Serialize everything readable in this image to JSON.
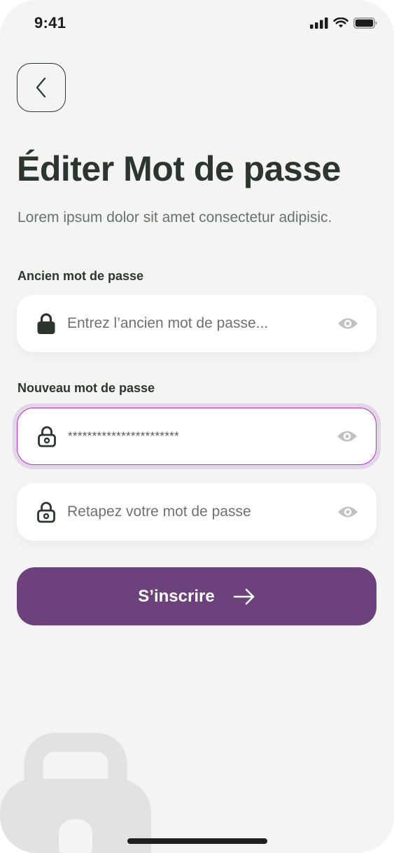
{
  "status_bar": {
    "time": "9:41",
    "icons": [
      "signal-icon",
      "wifi-icon",
      "battery-icon"
    ]
  },
  "header": {
    "back_icon": "chevron-left-icon",
    "title": "Éditer Mot de passe",
    "subtitle": "Lorem ipsum dolor sit amet consectetur adipisic."
  },
  "form": {
    "old_password": {
      "label": "Ancien mot de passe",
      "placeholder": "Entrez l’ancien mot de passe...",
      "value": "",
      "icon": "lock-icon",
      "toggle_icon": "eye-icon"
    },
    "new_password": {
      "label": "Nouveau mot de passe",
      "value": "***********************",
      "icon": "lock-icon",
      "toggle_icon": "eye-icon",
      "focused": true
    },
    "confirm_password": {
      "placeholder": "Retapez votre mot de passe",
      "value": "",
      "icon": "lock-icon",
      "toggle_icon": "eye-icon"
    },
    "submit": {
      "label": "S’inscrire",
      "icon": "arrow-right-icon"
    }
  },
  "colors": {
    "background": "#f4f4f4",
    "text_primary": "#2c362f",
    "text_secondary": "#6b706c",
    "accent": "#6c417c",
    "focus_border": "#b72fd6",
    "focus_ring": "#e1d5e6",
    "icon_muted": "#c2c2c2"
  }
}
